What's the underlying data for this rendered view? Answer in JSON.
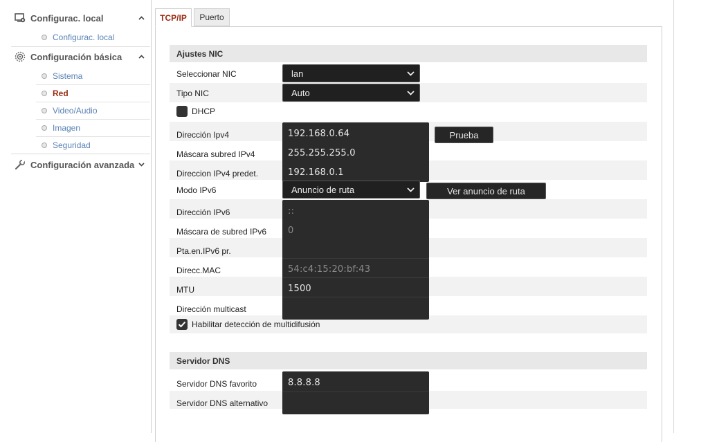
{
  "sidebar": {
    "sections": [
      {
        "title": "Configurac. local",
        "icon": "monitor-gear-icon",
        "chevron": "up",
        "items": [
          {
            "label": "Configurac. local"
          }
        ]
      },
      {
        "title": "Configuración básica",
        "icon": "gear-icon",
        "chevron": "up",
        "items": [
          {
            "label": "Sistema"
          },
          {
            "label": "Red",
            "active": true
          },
          {
            "label": "Video/Audio"
          },
          {
            "label": "Imagen"
          },
          {
            "label": "Seguridad"
          }
        ]
      },
      {
        "title": "Configuración avanzada",
        "icon": "wrench-icon",
        "chevron": "down",
        "items": []
      }
    ]
  },
  "tabs": [
    {
      "label": "TCP/IP",
      "active": true
    },
    {
      "label": "Puerto",
      "active": false
    }
  ],
  "nic_section": {
    "header": "Ajustes NIC",
    "select_nic": {
      "label": "Seleccionar NIC",
      "value": "lan"
    },
    "nic_type": {
      "label": "Tipo NIC",
      "value": "Auto"
    },
    "dhcp": {
      "label": "DHCP",
      "checked": false
    },
    "ipv4_address": {
      "label": "Dirección Ipv4",
      "value": "192.168.0.64"
    },
    "test_button": "Prueba",
    "ipv4_mask": {
      "label": "Máscara subred IPv4",
      "value": "255.255.255.0"
    },
    "ipv4_gateway": {
      "label": "Direccion IPv4 predet.",
      "value": "192.168.0.1"
    },
    "ipv6_mode": {
      "label": "Modo IPv6",
      "value": "Anuncio de ruta"
    },
    "route_adv_button": "Ver anuncio de ruta",
    "ipv6_address": {
      "label": "Dirección IPv6",
      "value": "::"
    },
    "ipv6_mask": {
      "label": "Máscara de subred IPv6",
      "value": "0"
    },
    "ipv6_gateway": {
      "label": "Pta.en.IPv6 pr.",
      "value": ""
    },
    "mac": {
      "label": "Direcc.MAC",
      "value": "54:c4:15:20:bf:43"
    },
    "mtu": {
      "label": "MTU",
      "value": "1500"
    },
    "multicast": {
      "label": "Dirección multicast",
      "value": ""
    },
    "multicast_discovery": {
      "label": "Habilitar detección de multidifusión",
      "checked": true
    }
  },
  "dns_section": {
    "header": "Servidor DNS",
    "preferred": {
      "label": "Servidor DNS favorito",
      "value": "8.8.8.8"
    },
    "alternate": {
      "label": "Servidor DNS alternativo",
      "value": ""
    }
  },
  "colors": {
    "accent": "#9a2c12",
    "link": "#5a82b5",
    "dark_field": "#2b2b2b"
  }
}
